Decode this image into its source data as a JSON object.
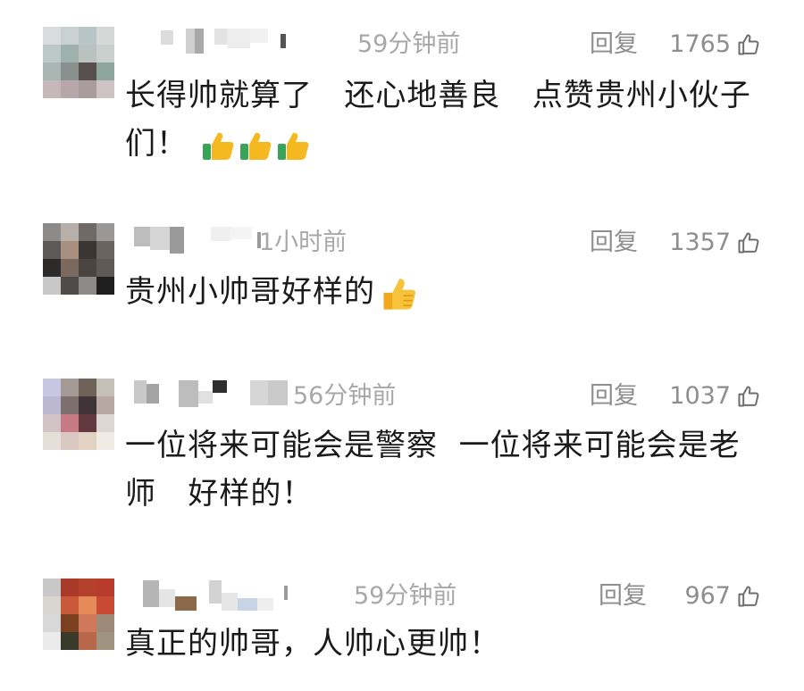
{
  "comments": [
    {
      "time": "59分钟前",
      "reply_label": "回复",
      "like_count": "1765",
      "text": "长得帅就算了   还心地善良   点赞贵州小伙子们！",
      "emoji": "thumbs-up-icon x3"
    },
    {
      "time": "1小时前",
      "reply_label": "回复",
      "like_count": "1357",
      "text": "贵州小帅哥好样的",
      "emoji": "thumbs-up-icon"
    },
    {
      "time": "56分钟前",
      "reply_label": "回复",
      "like_count": "1037",
      "text": "一位将来可能会是警察  一位将来可能会是老师   好样的！",
      "emoji": ""
    },
    {
      "time": "59分钟前",
      "reply_label": "回复",
      "like_count": "967",
      "text": "真正的帅哥，人帅心更帅！",
      "emoji": ""
    }
  ],
  "colors": {
    "time": "#a8a8a8",
    "reply": "#8e8e8e",
    "text": "#1a1a1a",
    "emoji_yellow": "#f6b81f",
    "emoji_green": "#3aa35a"
  }
}
